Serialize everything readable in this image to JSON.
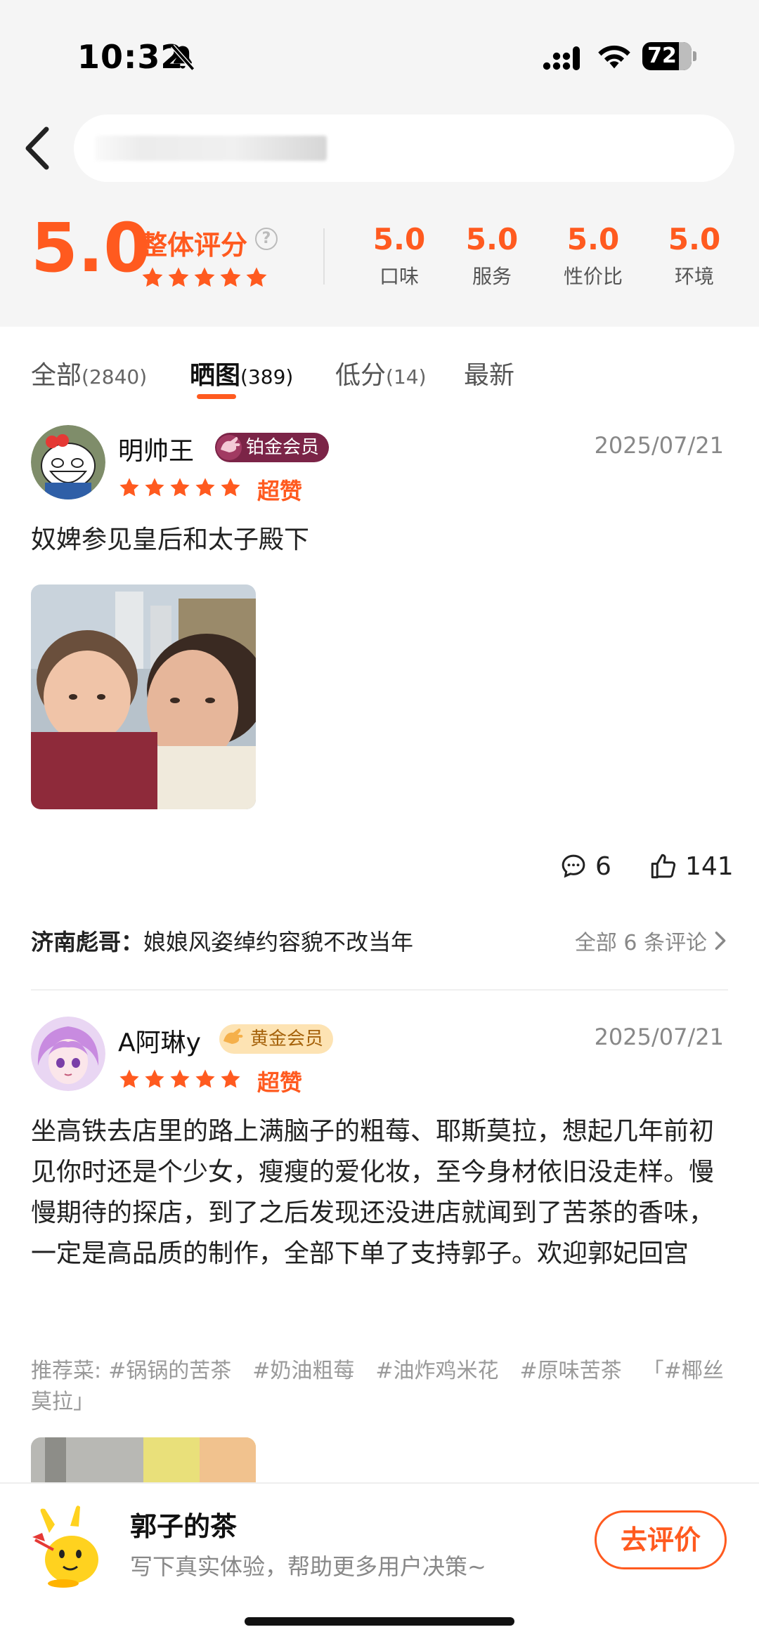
{
  "status_bar": {
    "time": "10:32",
    "battery": "72"
  },
  "summary": {
    "overall_score": "5.0",
    "overall_label": "整体评分",
    "help": "?",
    "sub_scores": [
      {
        "value": "5.0",
        "label": "口味"
      },
      {
        "value": "5.0",
        "label": "服务"
      },
      {
        "value": "5.0",
        "label": "性价比"
      },
      {
        "value": "5.0",
        "label": "环境"
      }
    ]
  },
  "tabs": [
    {
      "label": "全部",
      "count": "(2840)"
    },
    {
      "label": "晒图",
      "count": "(389)"
    },
    {
      "label": "低分",
      "count": "(14)"
    },
    {
      "label": "最新",
      "count": ""
    }
  ],
  "reviews": [
    {
      "username": "明帅王",
      "badge": "铂金会员",
      "date": "2025/07/21",
      "stars": 5,
      "rating_word": "超赞",
      "text": "奴婢参见皇后和太子殿下",
      "comments": "6",
      "likes": "141",
      "comment_preview": {
        "name": "济南彪哥：",
        "text": "娘娘风姿绰约容貌不改当年"
      },
      "all_comments": "全部 6 条评论"
    },
    {
      "username": "A阿琳y",
      "badge": "黄金会员",
      "date": "2025/07/21",
      "stars": 5,
      "rating_word": "超赞",
      "text": "坐高铁去店里的路上满脑子的粗莓、耶斯莫拉，想起几年前初见你时还是个少女，瘦瘦的爱化妆，至今身材依旧没走样。慢慢期待的探店，到了之后发现还没进店就闻到了苦茶的香味，一定是高品质的制作，全部下单了支持郭子。欢迎郭妃回宫",
      "tags_label": "推荐菜:",
      "tags": [
        "#锅锅的苦茶",
        "#奶油粗莓",
        "#油炸鸡米花",
        "#原味苦茶",
        "「#椰丝莫拉」"
      ]
    }
  ],
  "bottom_bar": {
    "shop_name": "郭子的茶",
    "hint": "写下真实体验，帮助更多用户决策~",
    "button": "去评价"
  },
  "colors": {
    "accent": "#ff5a1f",
    "platinum_badge": "#7b2447",
    "gold_badge": "#fde3b3"
  }
}
